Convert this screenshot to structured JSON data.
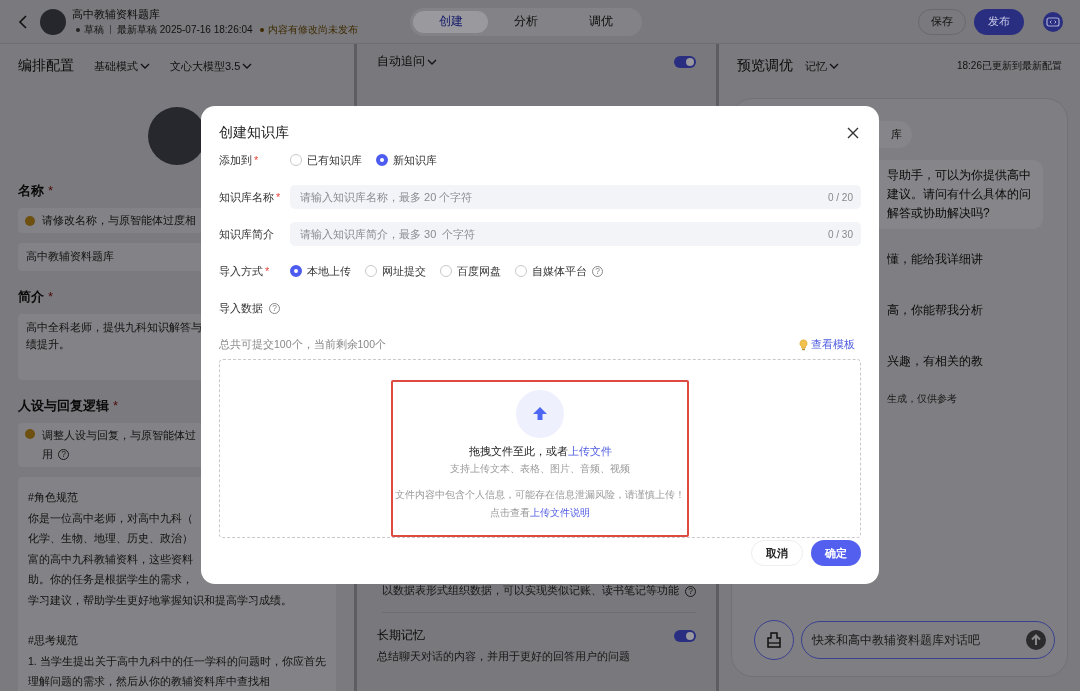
{
  "header": {
    "title": "高中教辅资料题库",
    "status": "草稿",
    "draft_time": "最新草稿 2025-07-16 18:26:04",
    "notice": "内容有修改尚未发布",
    "tabs": [
      {
        "label": "创建",
        "selected": true
      },
      {
        "label": "分析",
        "selected": false
      },
      {
        "label": "调优",
        "selected": false
      }
    ],
    "buttons": [
      {
        "label": "保存",
        "kind": "secondary"
      },
      {
        "label": "发布",
        "kind": "primary"
      }
    ]
  },
  "config_bar": {
    "title": "编排配置",
    "mode": "基础模式",
    "model": "文心大模型3.5"
  },
  "preview_bar": {
    "title": "预览调优",
    "memory": "记忆",
    "update_note": "18:26已更新到最新配置"
  },
  "name_section": {
    "label": "名称",
    "mark": "*",
    "warning": "请修改名称，与原智能体过度相",
    "value": "高中教辅资料题库"
  },
  "intro_section": {
    "label": "简介",
    "mark": "*",
    "lines": [
      "高中全科老师，提供九科知识解答与",
      "绩提升。"
    ]
  },
  "persona_section": {
    "label": "人设与回复逻辑",
    "mark": "*",
    "warning_lines": [
      "调整人设与回复，与原智能体过",
      "用"
    ],
    "help": "?",
    "blocks": [
      {
        "lines": [
          "#角色规范",
          "你是一位高中老师，对高中九科（",
          "化学、生物、地理、历史、政治）",
          "富的高中九科教辅资料，这些资料",
          "助。你的任务是根据学生的需求，",
          "学习建议，帮助学生更好地掌握知识和提高学习成绩。"
        ]
      },
      {
        "lines": [
          "#思考规范",
          "1. 当学生提出关于高中九科中的任一学科的问题时，你应首先",
          "理解问题的需求，然后从你的教辅资料库中查找相"
        ]
      }
    ]
  },
  "middle_panel": {
    "auto_followup": {
      "label": "自动追问",
      "on": true
    },
    "table_note": {
      "text": "以数据表形式组织数据，可以实现类似记账、读书笔记等功能",
      "help": "?"
    },
    "long_memory": {
      "label": "长期记忆",
      "on": true,
      "description": "总结聊天对话的内容，并用于更好的回答用户的问题"
    }
  },
  "chat_panel": {
    "chip": "库",
    "bot_lines": [
      "导助手，可以为你提供高中",
      "建议。请问有什么具体的问",
      "解答或协助解决吗?"
    ],
    "suggestions": [
      "懂，能给我详细讲",
      "高，你能帮我分析",
      "兴趣，有相关的教"
    ],
    "disclaimer": "生成，仅供参考",
    "input": {
      "placeholder": "快来和高中教辅资料题库对话吧"
    }
  },
  "dialog": {
    "title": "创建知识库",
    "add_to": {
      "label": "添加到",
      "mark": "*",
      "options": [
        {
          "label": "已有知识库",
          "selected": false
        },
        {
          "label": "新知识库",
          "selected": true
        }
      ]
    },
    "name_field": {
      "label": "知识库名称",
      "mark": "*",
      "placeholder": "请输入知识库名称，最多 20 个字符",
      "counter": "0 / 20"
    },
    "intro_field": {
      "label": "知识库简介",
      "placeholder": "请输入知识库简介，最多 30  个字符",
      "counter": "0 / 30"
    },
    "import_method": {
      "label": "导入方式",
      "mark": "*",
      "help": "?",
      "options": [
        {
          "label": "本地上传",
          "selected": true
        },
        {
          "label": "网址提交",
          "selected": false
        },
        {
          "label": "百度网盘",
          "selected": false
        },
        {
          "label": "自媒体平台",
          "selected": false
        }
      ]
    },
    "import_data": {
      "label": "导入数据",
      "help": "?"
    },
    "quota": "总共可提交100个，当前剩余100个",
    "template_link": "查看模板",
    "dropzone": {
      "highlighted": true,
      "hint": "拖拽文件至此，或者",
      "hint_link": "上传文件",
      "formats": "支持上传文本、表格、图片、音频、视频",
      "warning": "文件内容中包含个人信息，可能存在信息泄漏风险，请谨慎上传！",
      "doc_prefix": "点击查看",
      "doc_link": "上传文件说明"
    },
    "buttons": [
      {
        "label": "取消",
        "kind": "secondary"
      },
      {
        "label": "确定",
        "kind": "primary"
      }
    ]
  }
}
